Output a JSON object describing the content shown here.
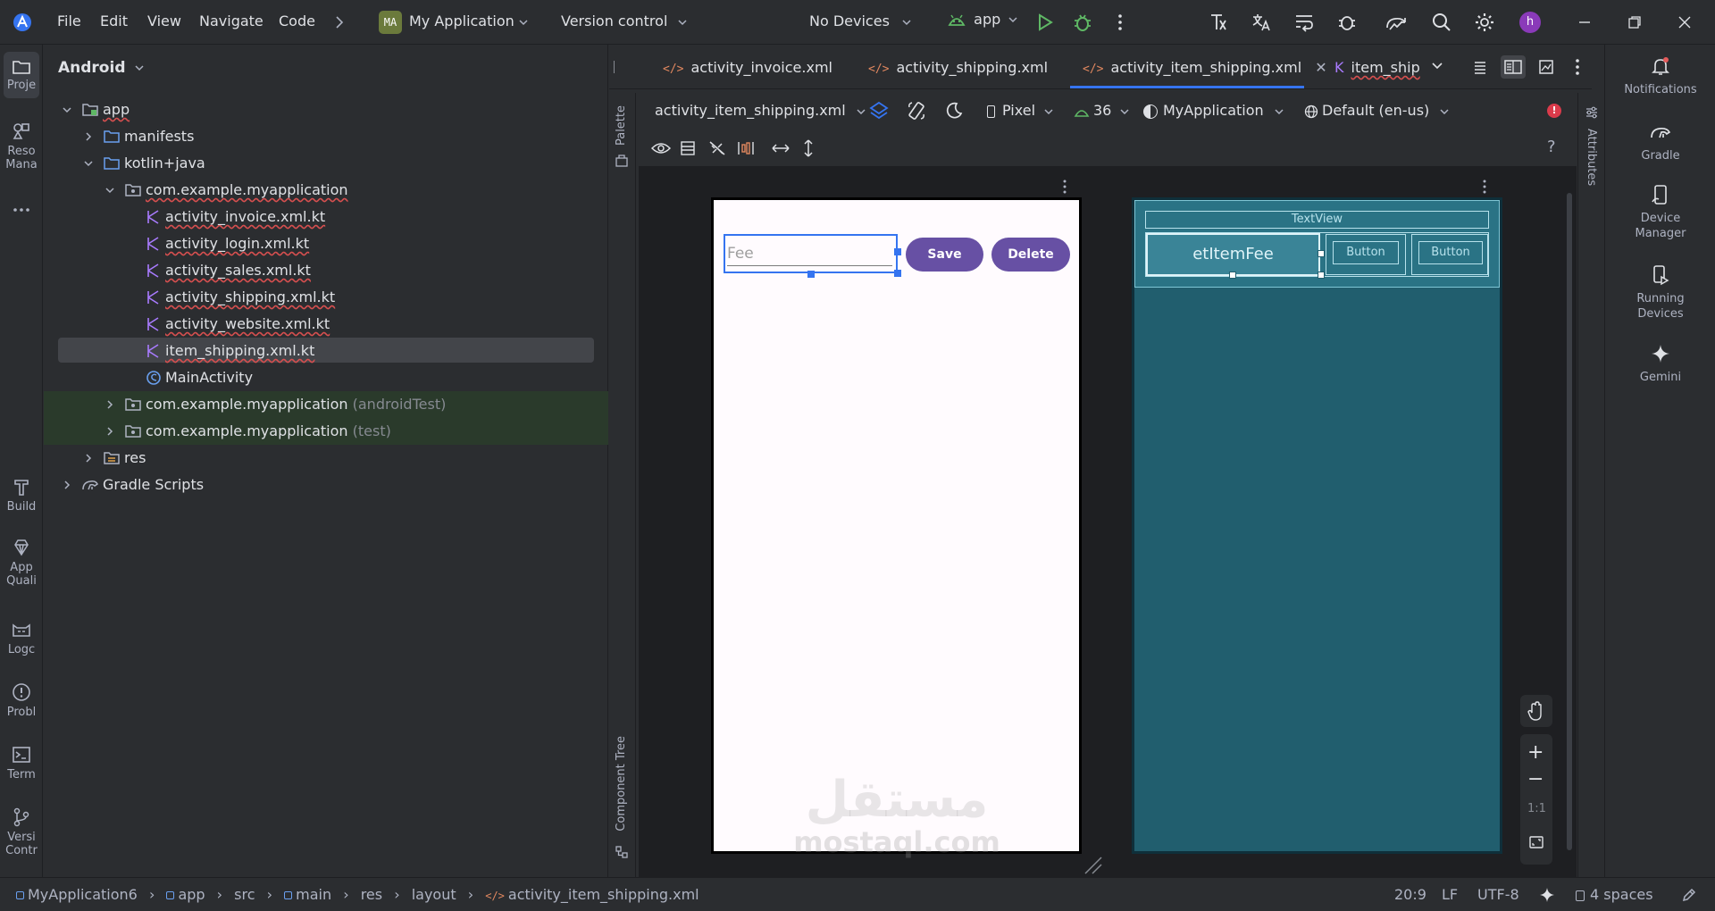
{
  "titlebar": {
    "menu": [
      "File",
      "Edit",
      "View",
      "Navigate",
      "Code"
    ],
    "project_badge": "MA",
    "project_name": "My Application",
    "version_control": "Version control",
    "devices": "No Devices",
    "run_config": "app",
    "avatar_letter": "h"
  },
  "left_tools": {
    "project": "Proje",
    "resource_manager": "Reso\nMana",
    "build": "Build",
    "app_quality": "App\nQuali",
    "logcat": "Logc",
    "problems": "Probl",
    "terminal": "Term",
    "version_control": "Versi\nContr"
  },
  "project_panel": {
    "view_selector": "Android",
    "tree": [
      {
        "label": "app"
      },
      {
        "label": "manifests"
      },
      {
        "label": "kotlin+java"
      },
      {
        "label": "com.example.myapplication"
      },
      {
        "label": "activity_invoice.xml.kt"
      },
      {
        "label": "activity_login.xml.kt"
      },
      {
        "label": "activity_sales.xml.kt"
      },
      {
        "label": "activity_shipping.xml.kt"
      },
      {
        "label": "activity_website.xml.kt"
      },
      {
        "label": "item_shipping.xml.kt"
      },
      {
        "label": "MainActivity"
      },
      {
        "label": "com.example.myapplication",
        "suffix": "(androidTest)"
      },
      {
        "label": "com.example.myapplication",
        "suffix": "(test)"
      },
      {
        "label": "res"
      },
      {
        "label": "Gradle Scripts"
      }
    ]
  },
  "tabs": [
    {
      "label": "activity_invoice.xml"
    },
    {
      "label": "activity_shipping.xml"
    },
    {
      "label": "activity_item_shipping.xml"
    },
    {
      "label": "item_ship"
    }
  ],
  "design_toolbar": {
    "file": "activity_item_shipping.xml",
    "device": "Pixel",
    "api": "36",
    "theme": "MyApplication",
    "locale": "Default (en-us)"
  },
  "side_labels": {
    "palette": "Palette",
    "component_tree": "Component Tree",
    "attributes": "Attributes"
  },
  "design_preview": {
    "fee_hint": "Fee",
    "save": "Save",
    "delete": "Delete"
  },
  "blueprint": {
    "textview": "TextView",
    "et_item_fee": "etItemFee",
    "button1": "Button",
    "button2": "Button"
  },
  "zoom": {
    "ratio": "1:1"
  },
  "watermark": {
    "arabic": "مستقل",
    "latin": "mostaql.com"
  },
  "right_tools": {
    "notifications": "Notifications",
    "gradle": "Gradle",
    "device_manager": "Device\nManager",
    "running_devices": "Running\nDevices",
    "gemini": "Gemini"
  },
  "statusbar": {
    "crumbs": [
      "MyApplication6",
      "app",
      "src",
      "main",
      "res",
      "layout",
      "activity_item_shipping.xml"
    ],
    "position": "20:9",
    "line_sep": "LF",
    "encoding": "UTF-8",
    "indent": "4 spaces"
  },
  "colors": {
    "accent": "#3574f0",
    "purple_button": "#6750a4",
    "blueprint_bg": "#215e6e",
    "selection_row": "#43454a",
    "test_folder_bg": "#2a3a2b"
  }
}
